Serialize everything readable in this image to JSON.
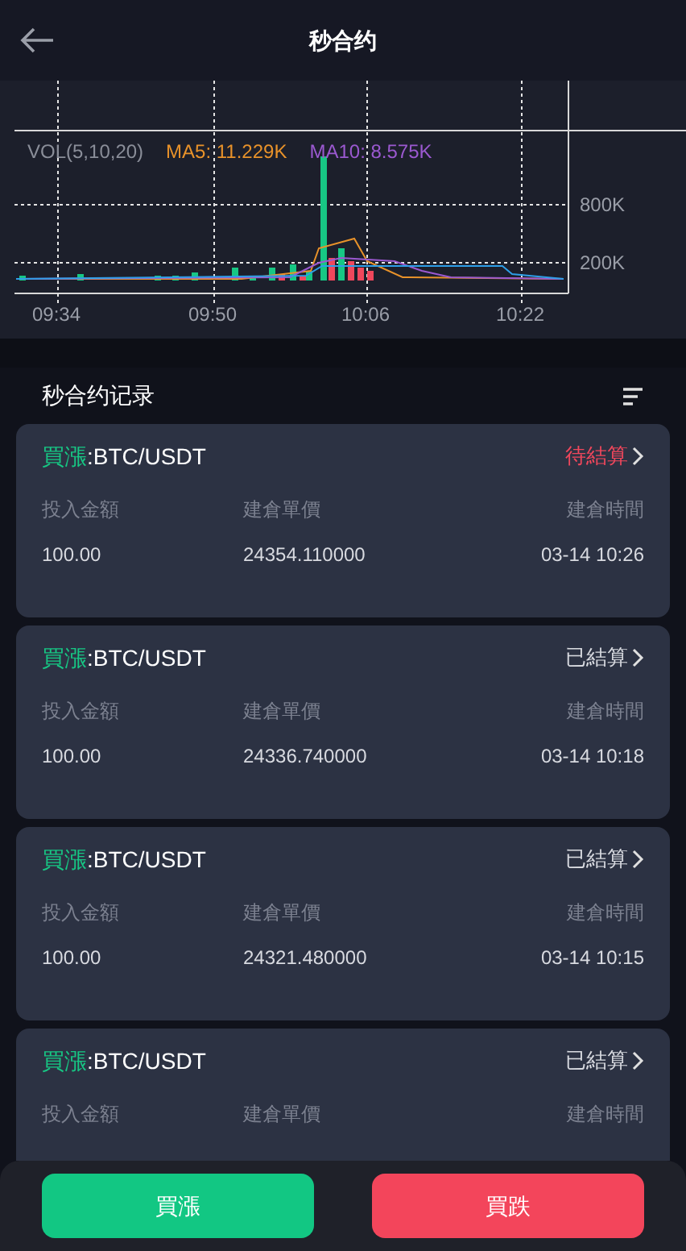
{
  "header": {
    "title": "秒合约"
  },
  "chart": {
    "indicator": "VOL(5,10,20)",
    "ma5": "MA5: 11.229K",
    "ma10": "MA10: 8.575K",
    "y_labels": [
      "800K",
      "200K"
    ],
    "x_labels": [
      "09:34",
      "09:50",
      "10:06",
      "10:22"
    ]
  },
  "records": {
    "title": "秒合约记录",
    "items": [
      {
        "direction": "買漲",
        "pair": ":BTC/USDT",
        "status": "待結算",
        "settled": false,
        "columns": [
          "投入金額",
          "建倉單價",
          "建倉時間"
        ],
        "values": [
          "100.00",
          "24354.110000",
          "03-14 10:26"
        ]
      },
      {
        "direction": "買漲",
        "pair": ":BTC/USDT",
        "status": "已結算",
        "settled": true,
        "columns": [
          "投入金額",
          "建倉單價",
          "建倉時間"
        ],
        "values": [
          "100.00",
          "24336.740000",
          "03-14 10:18"
        ]
      },
      {
        "direction": "買漲",
        "pair": ":BTC/USDT",
        "status": "已結算",
        "settled": true,
        "columns": [
          "投入金額",
          "建倉單價",
          "建倉時間"
        ],
        "values": [
          "100.00",
          "24321.480000",
          "03-14 10:15"
        ]
      },
      {
        "direction": "買漲",
        "pair": ":BTC/USDT",
        "status": "已結算",
        "settled": true,
        "columns": [
          "投入金額",
          "建倉單價",
          "建倉時間"
        ]
      }
    ]
  },
  "actions": [
    {
      "label": "買漲",
      "kind": "buy"
    },
    {
      "label": "買跌",
      "kind": "sell"
    }
  ]
}
